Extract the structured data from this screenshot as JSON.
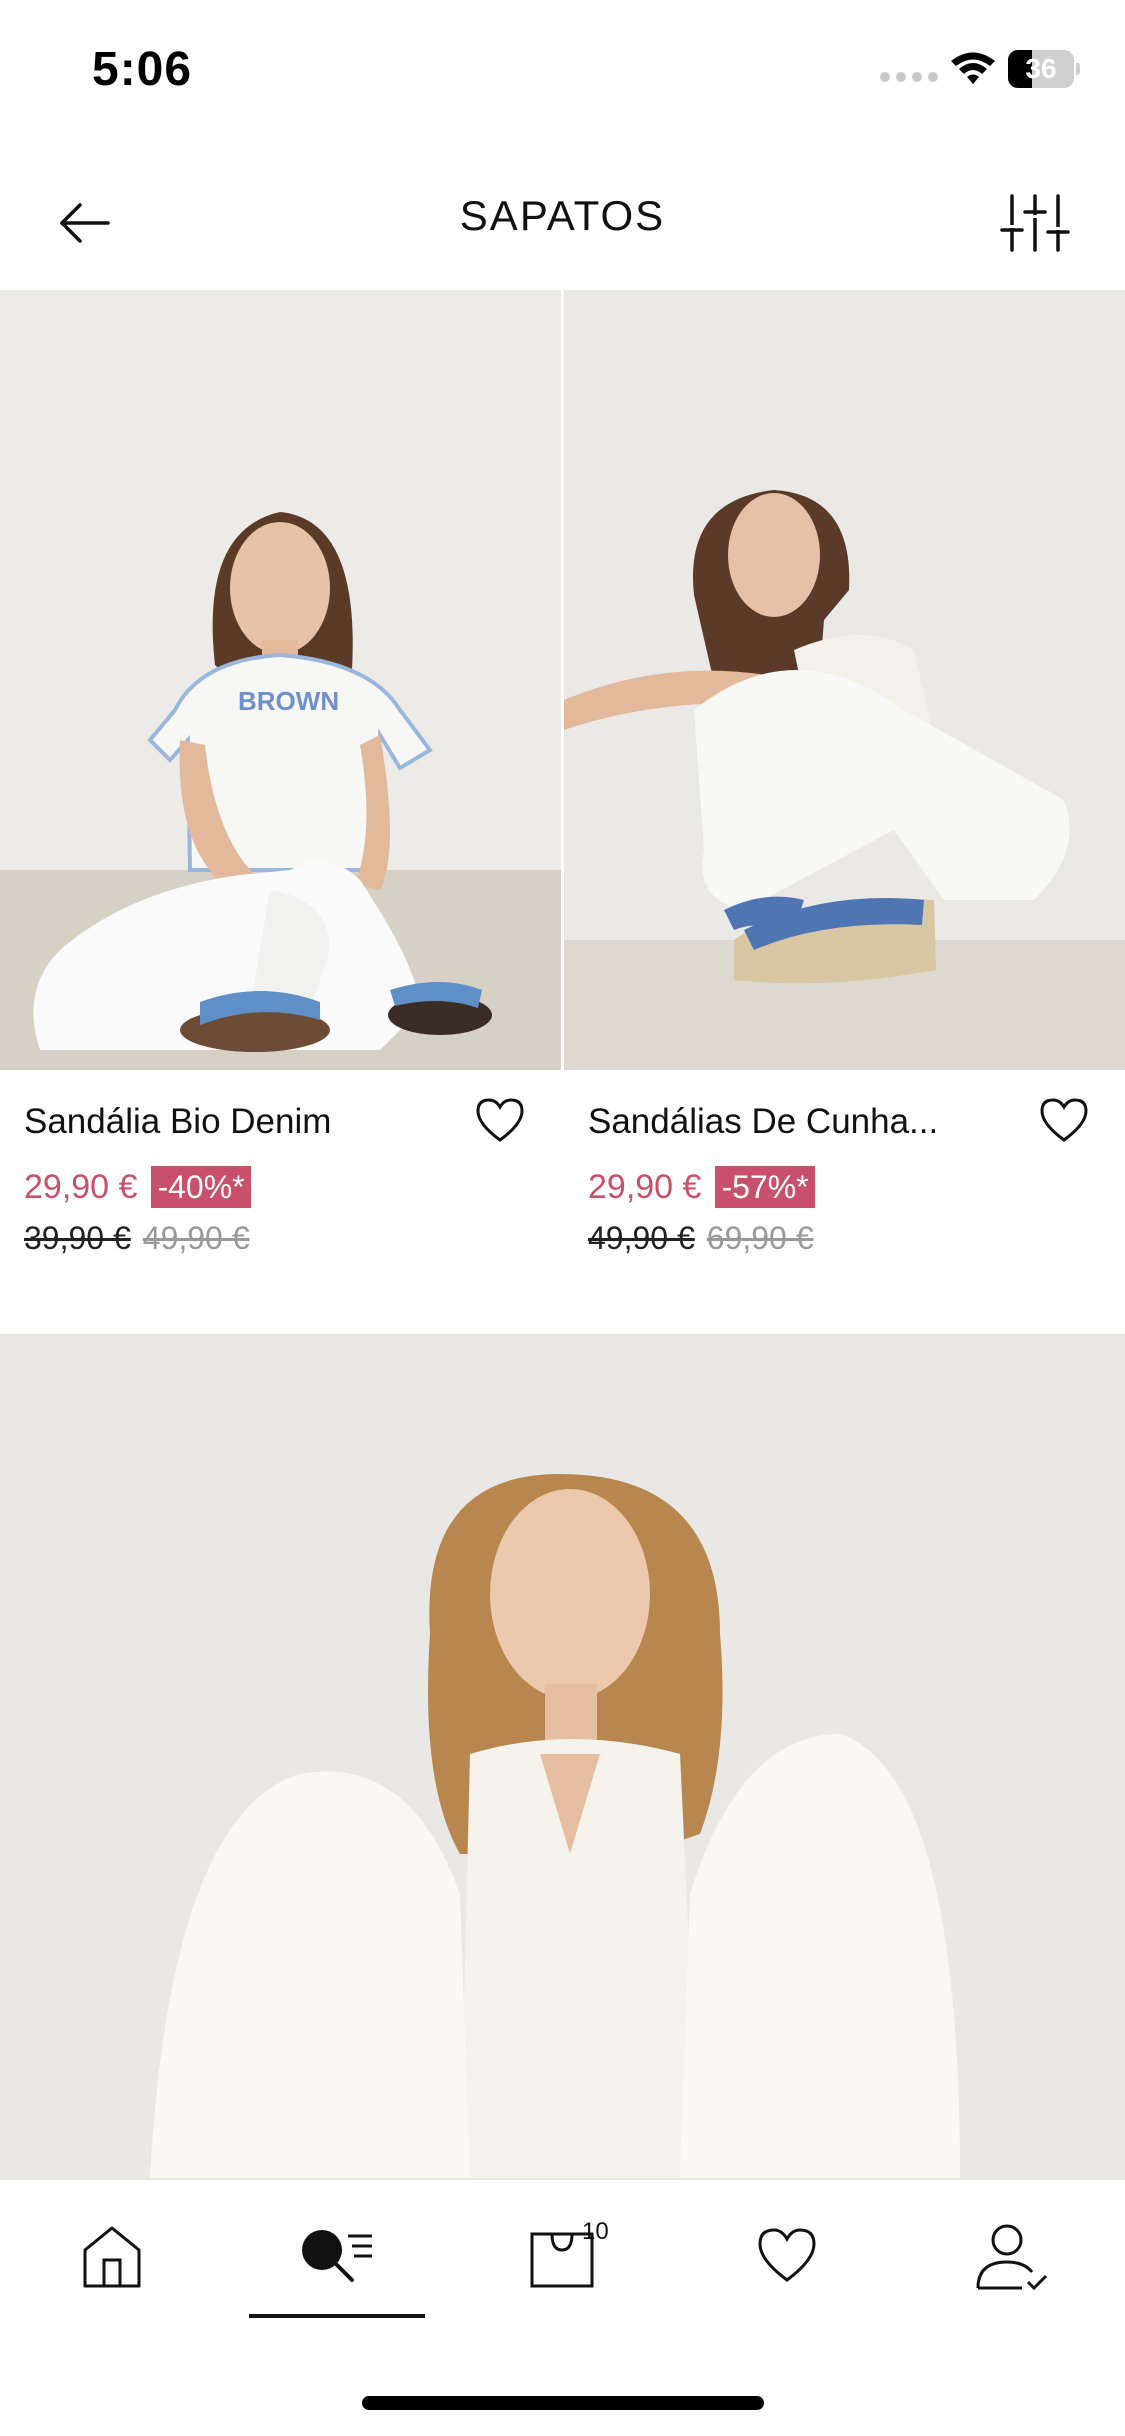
{
  "status_bar": {
    "time": "5:06",
    "battery_level": "36",
    "battery_fraction": 0.36
  },
  "header": {
    "title": "SAPATOS",
    "back_icon": "arrow-left-icon",
    "filter_icon": "sliders-icon"
  },
  "products": [
    {
      "name": "Sandália Bio Denim",
      "price": "29,90 €",
      "discount": "-40%*",
      "old_price_1": "39,90 €",
      "old_price_2": "49,90 €",
      "favorite_icon": "heart-outline-icon"
    },
    {
      "name": "Sandálias De Cunha...",
      "price": "29,90 €",
      "discount": "-57%*",
      "old_price_1": "49,90 €",
      "old_price_2": "69,90 €",
      "favorite_icon": "heart-outline-icon"
    }
  ],
  "bottom_nav": {
    "items": [
      {
        "icon": "home-icon"
      },
      {
        "icon": "search-menu-icon",
        "active": true
      },
      {
        "icon": "shopping-bag-icon",
        "badge": "10"
      },
      {
        "icon": "heart-icon"
      },
      {
        "icon": "account-icon"
      }
    ]
  },
  "colors": {
    "accent": "#c8506a",
    "text": "#111111",
    "background": "#ffffff"
  }
}
